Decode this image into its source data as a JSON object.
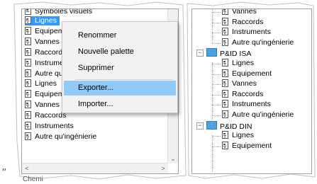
{
  "left_tree": {
    "header_text": "Symboles visuels",
    "items": [
      {
        "label": "Lignes",
        "selected": true
      },
      {
        "label": "Equipement"
      },
      {
        "label": "Vannes"
      },
      {
        "label": "Raccords"
      },
      {
        "label": "Instruments"
      },
      {
        "label": "Autre qu'ingénierie"
      },
      {
        "label": "Lignes"
      },
      {
        "label": "Equipement"
      },
      {
        "label": "Vannes"
      },
      {
        "label": "Raccords"
      },
      {
        "label": "Instruments"
      },
      {
        "label": "Autre qu'ingénierie"
      }
    ],
    "visible_fragments": [
      "Eq",
      "Va",
      "Ra",
      "Ins",
      "Au",
      "Lig",
      "Eq"
    ]
  },
  "context_menu": {
    "items": [
      {
        "label": "Renommer"
      },
      {
        "label": "Nouvelle palette"
      },
      {
        "label": "Supprimer"
      },
      {
        "label": "Exporter...",
        "highlighted": true
      },
      {
        "label": "Importer..."
      }
    ]
  },
  "right_tree": {
    "rows": [
      {
        "type": "child",
        "label": "Vannes"
      },
      {
        "type": "child",
        "label": "Raccords"
      },
      {
        "type": "child",
        "label": "Instruments"
      },
      {
        "type": "child",
        "label": "Autre qu'ingénierie"
      },
      {
        "type": "group",
        "label": "P&ID ISA"
      },
      {
        "type": "child",
        "label": "Lignes"
      },
      {
        "type": "child",
        "label": "Equipement"
      },
      {
        "type": "child",
        "label": "Vannes"
      },
      {
        "type": "child",
        "label": "Raccords"
      },
      {
        "type": "child",
        "label": "Instruments"
      },
      {
        "type": "child",
        "label": "Autre qu'ingénierie"
      },
      {
        "type": "group",
        "label": "P&ID DIN"
      },
      {
        "type": "child",
        "label": "Lignes"
      },
      {
        "type": "child",
        "label": "Equipement"
      }
    ]
  },
  "status": {
    "text": "Chemi"
  },
  "quote": "\"",
  "colors": {
    "selection": "#3399ff",
    "menu_highlight": "#91c9f7",
    "folder": "#4aa3e0"
  },
  "icons": {
    "tree_item": "palette-doc-icon",
    "group": "folder-icon"
  }
}
